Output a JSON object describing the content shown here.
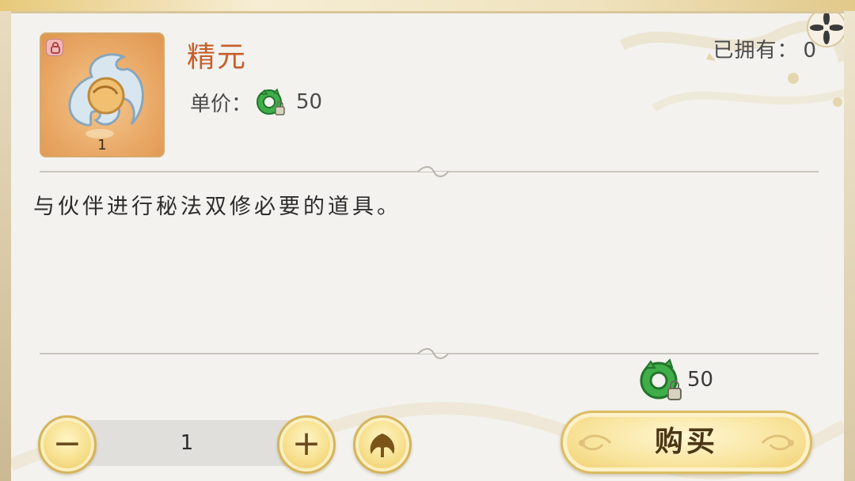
{
  "item": {
    "name": "精元",
    "count": "1",
    "description": "与伙伴进行秘法双修必要的道具。"
  },
  "owned": {
    "label": "已拥有：",
    "value": "0"
  },
  "price": {
    "label": "单价：",
    "value": "50",
    "icon": "jade-dragon-coin-icon"
  },
  "total": {
    "value": "50",
    "icon": "jade-dragon-coin-icon"
  },
  "quantity": {
    "value": "1",
    "minus_glyph": "−",
    "plus_glyph": "+"
  },
  "buy_button": {
    "label": "购买"
  },
  "colors": {
    "name": "#c65d2a",
    "panel": "#f3f2ee",
    "button_gold": "#f6de8a",
    "coin_green": "#3fae4a"
  }
}
